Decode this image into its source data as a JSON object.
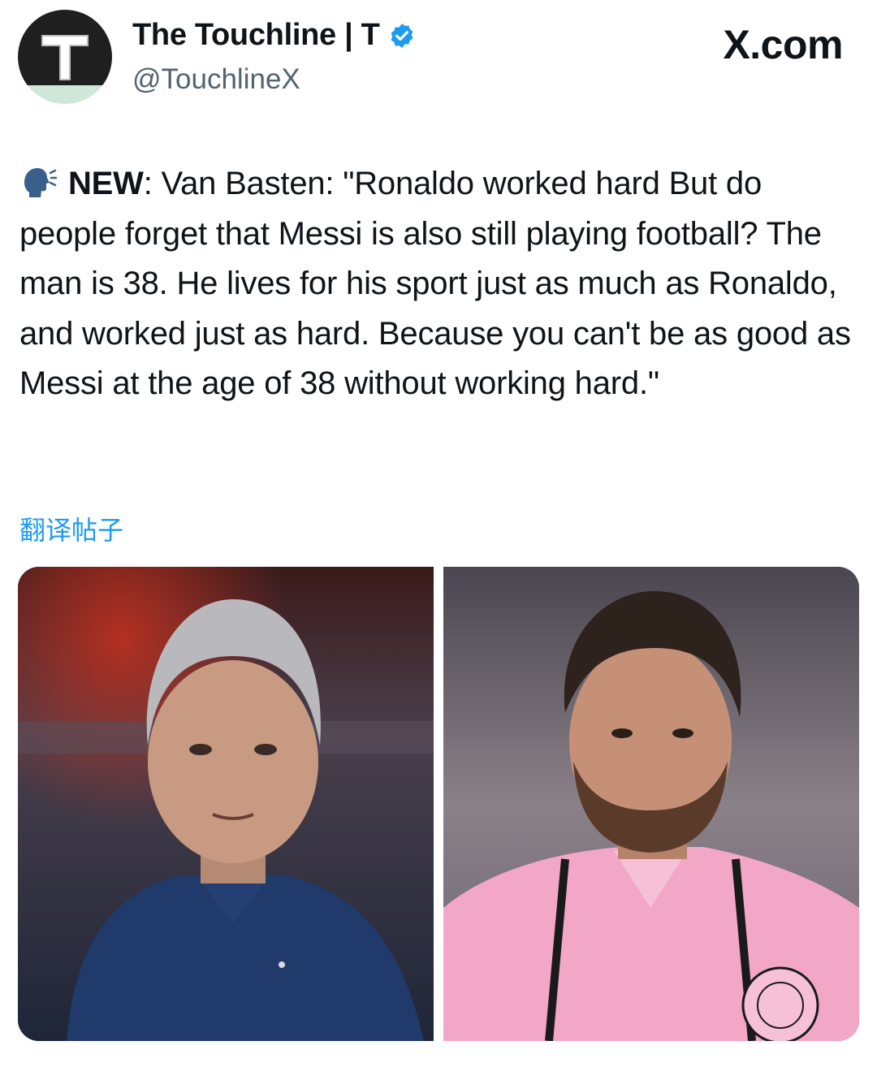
{
  "header": {
    "display_name": "The Touchline | T",
    "handle": "@TouchlineX",
    "watermark": "X.com",
    "avatar_letter": "T"
  },
  "tweet": {
    "icon": "speaking-head-icon",
    "tag": "NEW",
    "text_after_tag": ": Van Basten: \"Ronaldo worked hard But do people forget that Messi is also still playing football? The man is 38. He lives for his sport just as much as Ronaldo, and worked just as hard. Because you can't be as good as Messi at the age of 38 without working hard.\"",
    "translate_label": "翻译帖子"
  },
  "media": {
    "photos": [
      {
        "name": "photo-van-basten"
      },
      {
        "name": "photo-messi"
      }
    ]
  },
  "colors": {
    "accent": "#1d9bf0",
    "secondary_text": "#536471",
    "text": "#0f1419"
  }
}
